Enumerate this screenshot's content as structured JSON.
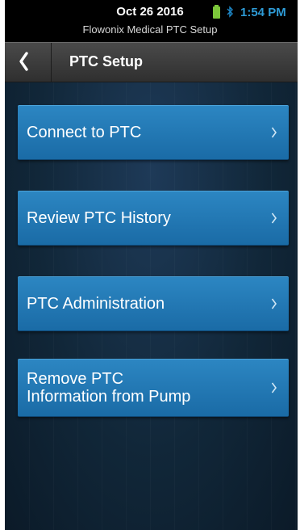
{
  "status_bar": {
    "date": "Oct 26 2016",
    "subtitle": "Flowonix Medical PTC Setup",
    "time": "1:54 PM",
    "battery_color": "#7cc63a",
    "bluetooth_icon": "bluetooth-icon"
  },
  "header": {
    "title": "PTC Setup",
    "back_icon": "chevron-left-icon"
  },
  "menu": {
    "items": [
      {
        "label": "Connect to PTC",
        "icon": "chevron-right-icon"
      },
      {
        "label": "Review PTC History",
        "icon": "chevron-right-icon"
      },
      {
        "label": "PTC Administration",
        "icon": "chevron-right-icon"
      },
      {
        "label": "Remove PTC\nInformation from Pump",
        "icon": "chevron-right-icon"
      }
    ]
  },
  "colors": {
    "button": "#2277b6",
    "status_time": "#2e9bd6",
    "background": "#112739"
  }
}
